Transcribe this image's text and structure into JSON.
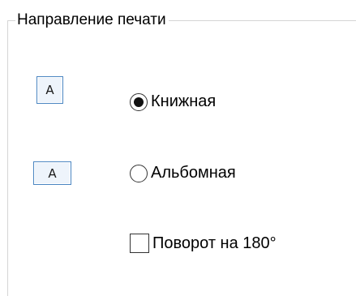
{
  "group": {
    "title": "Направление печати"
  },
  "orientation": {
    "portrait": {
      "icon_glyph": "A",
      "label": "Книжная",
      "selected": true
    },
    "landscape": {
      "icon_glyph": "A",
      "label": "Альбомная",
      "selected": false
    }
  },
  "rotate": {
    "label": "Поворот на 180°",
    "checked": false
  },
  "colors": {
    "icon_border": "#4b86c2",
    "icon_fill": "#eef4fb",
    "frame_line": "#d5d5d5"
  }
}
